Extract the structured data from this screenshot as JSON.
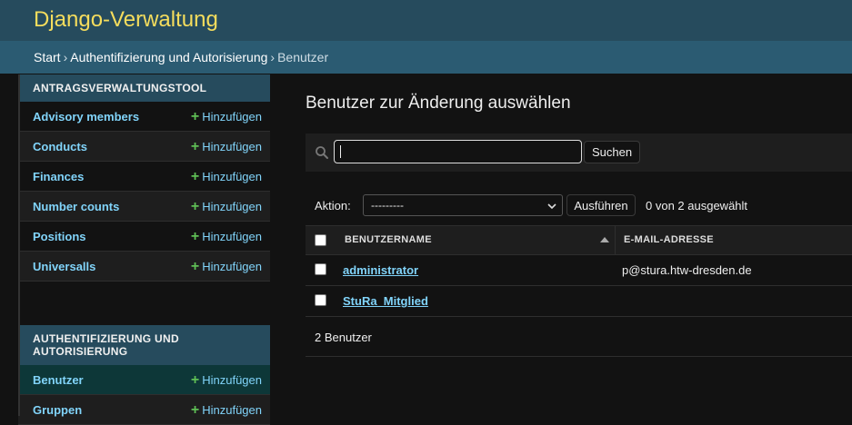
{
  "header": {
    "brand": "Django-Verwaltung"
  },
  "breadcrumbs": {
    "home": "Start",
    "app": "Authentifizierung und Autorisierung",
    "current": "Benutzer",
    "separator": "›"
  },
  "sidebar": {
    "add_label": "Hinzufügen",
    "modules": [
      {
        "caption": "ANTRAGSVERWALTUNGSTOOL",
        "models": [
          {
            "name": "Advisory members"
          },
          {
            "name": "Conducts"
          },
          {
            "name": "Finances"
          },
          {
            "name": "Number counts"
          },
          {
            "name": "Positions"
          },
          {
            "name": "Universalls"
          }
        ]
      },
      {
        "caption": "AUTHENTIFIZIERUNG UND AUTORISIERUNG",
        "models": [
          {
            "name": "Benutzer",
            "active": true
          },
          {
            "name": "Gruppen"
          }
        ]
      }
    ]
  },
  "content": {
    "title": "Benutzer zur Änderung auswählen",
    "search": {
      "value": "",
      "button": "Suchen",
      "icon": "search-icon"
    },
    "actions": {
      "label": "Aktion:",
      "selected_option": "---------",
      "go_button": "Ausführen",
      "selected_count": "0 von 2 ausgewählt"
    },
    "table": {
      "columns": [
        "BENUTZERNAME",
        "E-MAIL-ADRESSE"
      ],
      "rows": [
        {
          "username": "administrator",
          "email": "p@stura.htw-dresden.de"
        },
        {
          "username": "StuRa_Mitglied",
          "email": ""
        }
      ]
    },
    "paginator": "2 Benutzer"
  },
  "colors": {
    "header_bg": "#264b5d",
    "brand": "#f5dd5d",
    "link": "#81d4fa",
    "add_plus": "#5fbf55",
    "active_row": "#0d3738"
  }
}
